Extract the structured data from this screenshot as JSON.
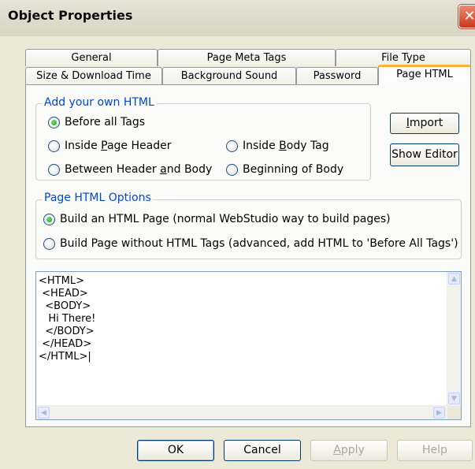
{
  "window": {
    "title": "Object Properties",
    "close_glyph": "✕"
  },
  "tabs_row1": [
    "General",
    "Page Meta Tags",
    "File Type"
  ],
  "tabs_row2": [
    "Size & Download Time",
    "Background Sound",
    "Password",
    "Page HTML"
  ],
  "active_tab": "Page HTML",
  "add_html": {
    "label": "Add your own HTML",
    "options": [
      {
        "pre": "Before all Tags",
        "u": "",
        "post": "",
        "checked": true
      },
      {
        "pre": "Inside ",
        "u": "P",
        "post": "age Header",
        "checked": false
      },
      {
        "pre": "Inside ",
        "u": "B",
        "post": "ody Tag",
        "checked": false
      },
      {
        "pre": "Between Header ",
        "u": "a",
        "post": "nd Body",
        "checked": false
      },
      {
        "pre": "Beginning of Body",
        "u": "",
        "post": "",
        "checked": false
      }
    ]
  },
  "buttons_side": {
    "import": {
      "pre": "",
      "u": "I",
      "post": "mport"
    },
    "show_editor": "Show Editor"
  },
  "options": {
    "label": "Page HTML Options",
    "items": [
      {
        "label": "Build an HTML Page (normal WebStudio way to build pages)",
        "checked": true
      },
      {
        "label": "Build Page without HTML Tags (advanced, add HTML to 'Before All Tags')",
        "checked": false
      }
    ]
  },
  "editor": {
    "content": "<HTML>\n <HEAD>\n  <BODY>\n   Hi There!\n  </BODY>\n </HEAD>\n</HTML>|"
  },
  "footer": {
    "ok": "OK",
    "cancel": "Cancel",
    "apply": {
      "pre": "",
      "u": "A",
      "post": "pply"
    },
    "help": "Help"
  },
  "colors": {
    "accent": "#0046d5",
    "tab_highlight": "#f8b43a",
    "dialog_bg": "#ECE9D8"
  }
}
